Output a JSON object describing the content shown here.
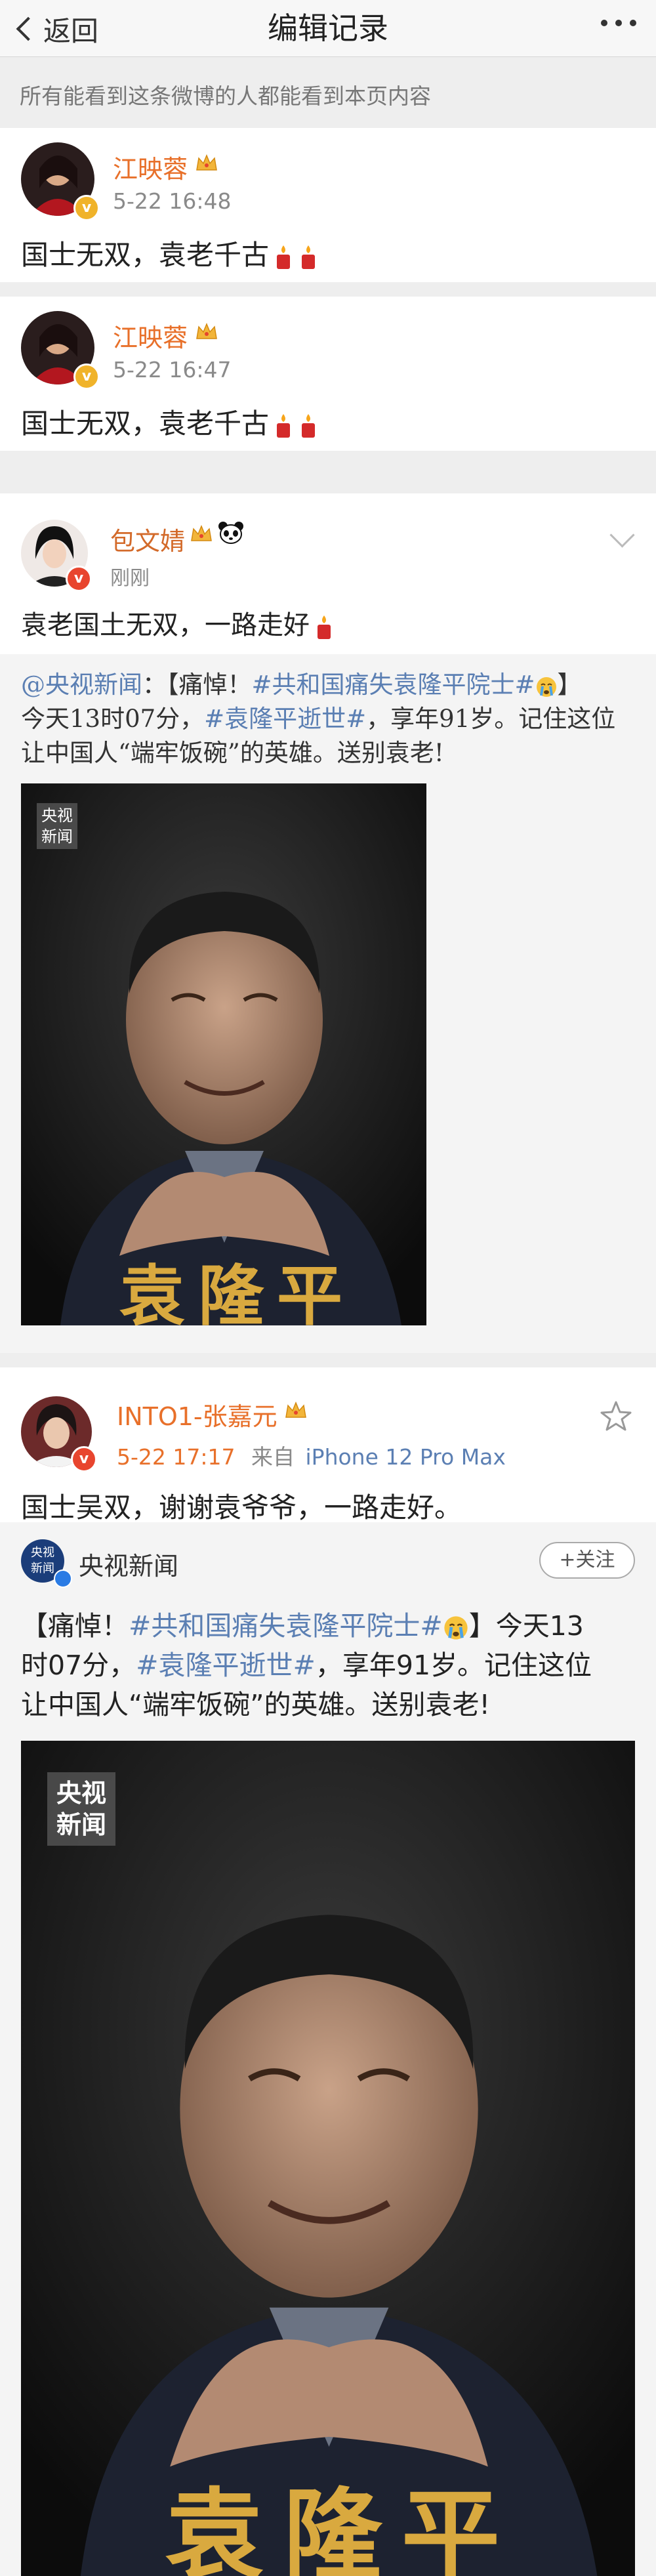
{
  "header": {
    "back_label": "返回",
    "title": "编辑记录"
  },
  "notice": "所有能看到这条微博的人都能看到本页内容",
  "records": [
    {
      "user": "江映蓉",
      "time": "5-22 16:48",
      "text": "国士无双，袁老千古"
    },
    {
      "user": "江映蓉",
      "time": "5-22 16:47",
      "text": "国士无双，袁老千古"
    }
  ],
  "post1": {
    "user": "包文婧",
    "time": "刚刚",
    "text": "袁老国土无双，一路走好",
    "repost": {
      "account": "@央视新闻",
      "colon": "：",
      "line1_pre": "【痛悼！",
      "line1_tag": "#共和国痛失袁隆平院士#",
      "line1_post": "】",
      "line2_pre": "今天13时07分，",
      "line2_tag": "#袁隆平逝世#",
      "line2_post": "，享年91岁。记住这位",
      "line3": "让中国人“端牢饭碗”的英雄。送别袁老!"
    },
    "watermark": [
      "央视",
      "新闻"
    ],
    "photo_caption": "袁隆平"
  },
  "post2": {
    "user": "INTO1-张嘉元",
    "time": "5-22 17:17",
    "source_prefix": "来自",
    "source": "iPhone 12 Pro Max",
    "text": "国士吴双，谢谢袁爷爷，一路走好。",
    "repost": {
      "account": "央视新闻",
      "follow_label": "+关注",
      "line1_pre": "【痛悼！",
      "line1_tag": "#共和国痛失袁隆平院士#",
      "line1_post": "】今天13",
      "line2_pre": "时07分，",
      "line2_tag": "#袁隆平逝世#",
      "line2_post": "，享年91岁。记住这位",
      "line3": "让中国人“端牢饭碗”的英雄。送别袁老!",
      "avatar_text": [
        "央视",
        "新闻"
      ]
    },
    "watermark": [
      "央视",
      "新闻"
    ],
    "photo_caption": "袁隆平"
  }
}
